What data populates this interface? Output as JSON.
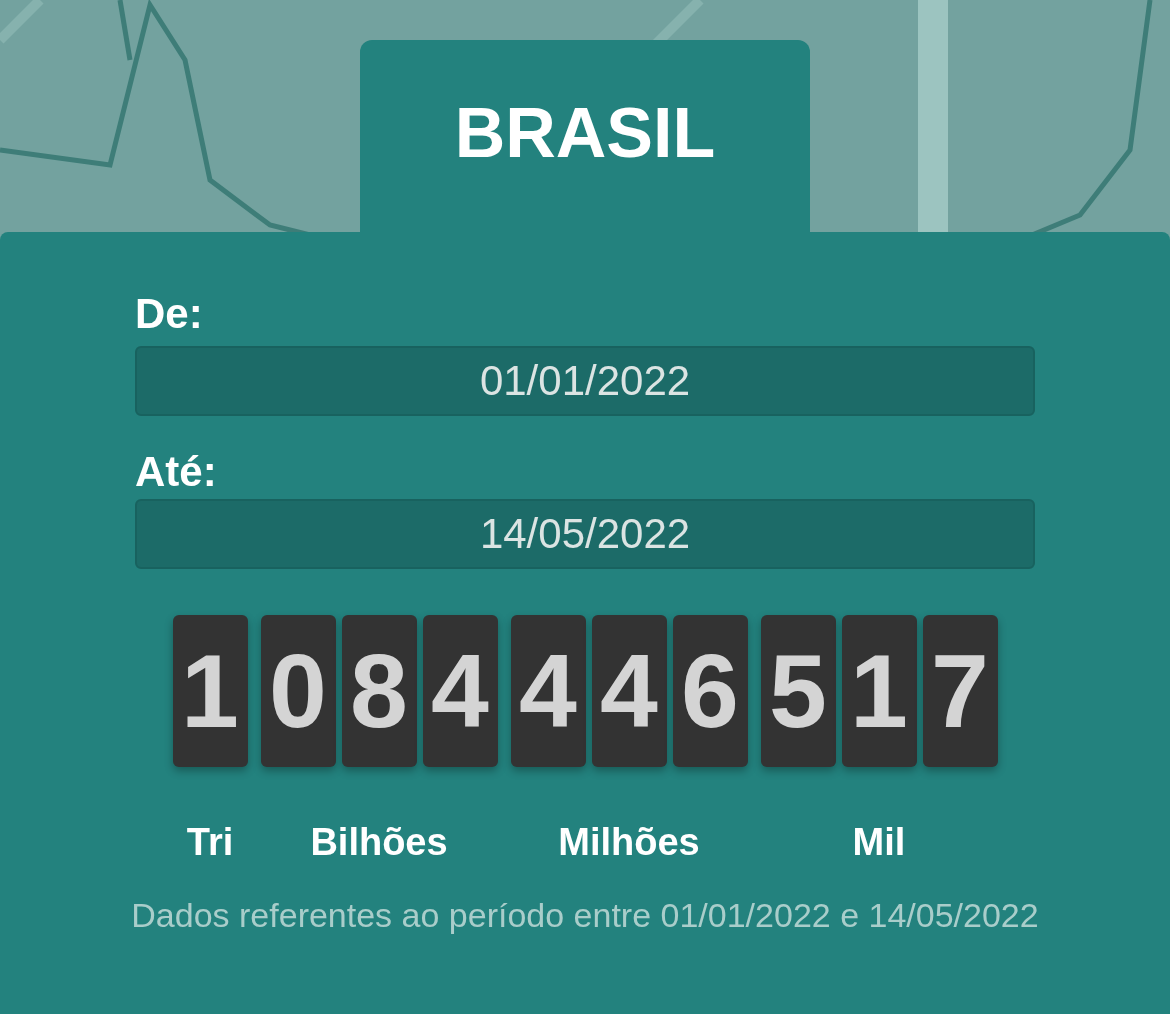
{
  "tab": {
    "title": "BRASIL"
  },
  "fields": [
    {
      "label": "De:",
      "value": "01/01/2022"
    },
    {
      "label": "Até:",
      "value": "14/05/2022"
    }
  ],
  "counter": {
    "groups": [
      {
        "digits": [
          "1"
        ],
        "label": "Tri"
      },
      {
        "digits": [
          "0",
          "8",
          "4"
        ],
        "label": "Bilhões"
      },
      {
        "digits": [
          "4",
          "4",
          "6"
        ],
        "label": "Milhões"
      },
      {
        "digits": [
          "5",
          "1",
          "7"
        ],
        "label": "Mil"
      }
    ]
  },
  "note": "Dados referentes ao período entre 01/01/2022 e 14/05/2022"
}
